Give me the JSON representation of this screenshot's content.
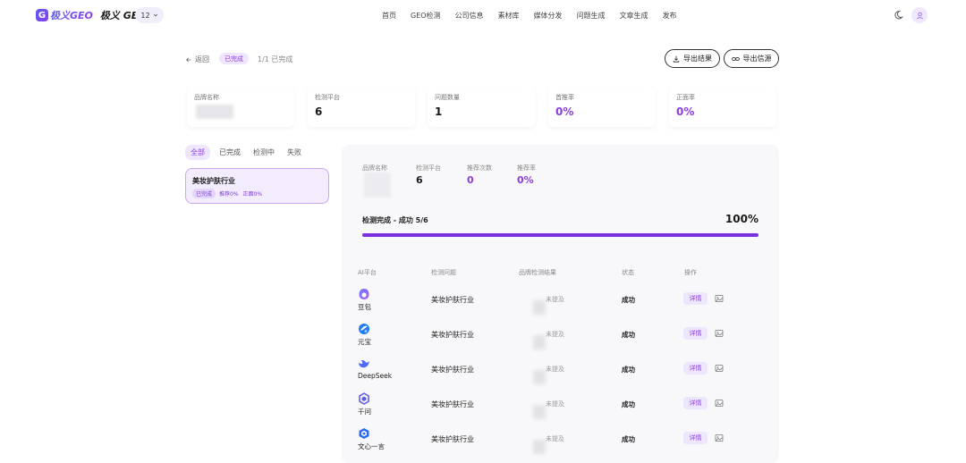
{
  "header": {
    "logo_letter": "G",
    "logo_brand": "极义GEO",
    "title": "极义 GEO",
    "version_pill": "12",
    "nav": [
      "首页",
      "GEO检测",
      "公司信息",
      "素材库",
      "媒体分发",
      "问题生成",
      "文章生成",
      "发布"
    ]
  },
  "toolbar": {
    "back_label": "返回",
    "status": "已完成",
    "progress": "1/1 已完成",
    "export_results": "导出结果",
    "export_sources": "导出信源"
  },
  "stats": [
    {
      "label": "品牌名称",
      "value": ""
    },
    {
      "label": "检测平台",
      "value": "6"
    },
    {
      "label": "问题数量",
      "value": "1"
    },
    {
      "label": "首推率",
      "value": "0%"
    },
    {
      "label": "正面率",
      "value": "0%"
    }
  ],
  "filters": [
    "全部",
    "已完成",
    "检测中",
    "失败"
  ],
  "task": {
    "title": "美妆护肤行业",
    "status_tag": "已完成",
    "recommend": "推荐0%",
    "positive": "正面0%"
  },
  "panel": {
    "stats": [
      {
        "label": "品牌名称",
        "value": ""
      },
      {
        "label": "检测平台",
        "value": "6"
      },
      {
        "label": "推荐次数",
        "value": "0"
      },
      {
        "label": "推荐率",
        "value": "0%"
      }
    ],
    "done_text": "检测完成 - 成功 5/6",
    "percent_text": "100%",
    "progress_fraction": 1.0,
    "table_headers": [
      "AI平台",
      "检测问题",
      "品牌检测结果",
      "状态",
      "操作"
    ],
    "rows": [
      {
        "platform": "豆包",
        "icon": "doubao-icon",
        "question": "美妆护肤行业",
        "result": "未提及",
        "status": "成功",
        "action": "详情"
      },
      {
        "platform": "元宝",
        "icon": "yuanbao-icon",
        "question": "美妆护肤行业",
        "result": "未提及",
        "status": "成功",
        "action": "详情"
      },
      {
        "platform": "DeepSeek",
        "icon": "deepseek-icon",
        "question": "美妆护肤行业",
        "result": "未提及",
        "status": "成功",
        "action": "详情"
      },
      {
        "platform": "千问",
        "icon": "qianwen-icon",
        "question": "美妆护肤行业",
        "result": "未提及",
        "status": "成功",
        "action": "详情"
      },
      {
        "platform": "文心一言",
        "icon": "wenxin-icon",
        "question": "美妆护肤行业",
        "result": "未提及",
        "status": "成功",
        "action": "详情"
      }
    ]
  },
  "colors": {
    "accent": "#8b3de0",
    "accent_light": "#ede6fc",
    "bar": "#7b2fe0"
  }
}
